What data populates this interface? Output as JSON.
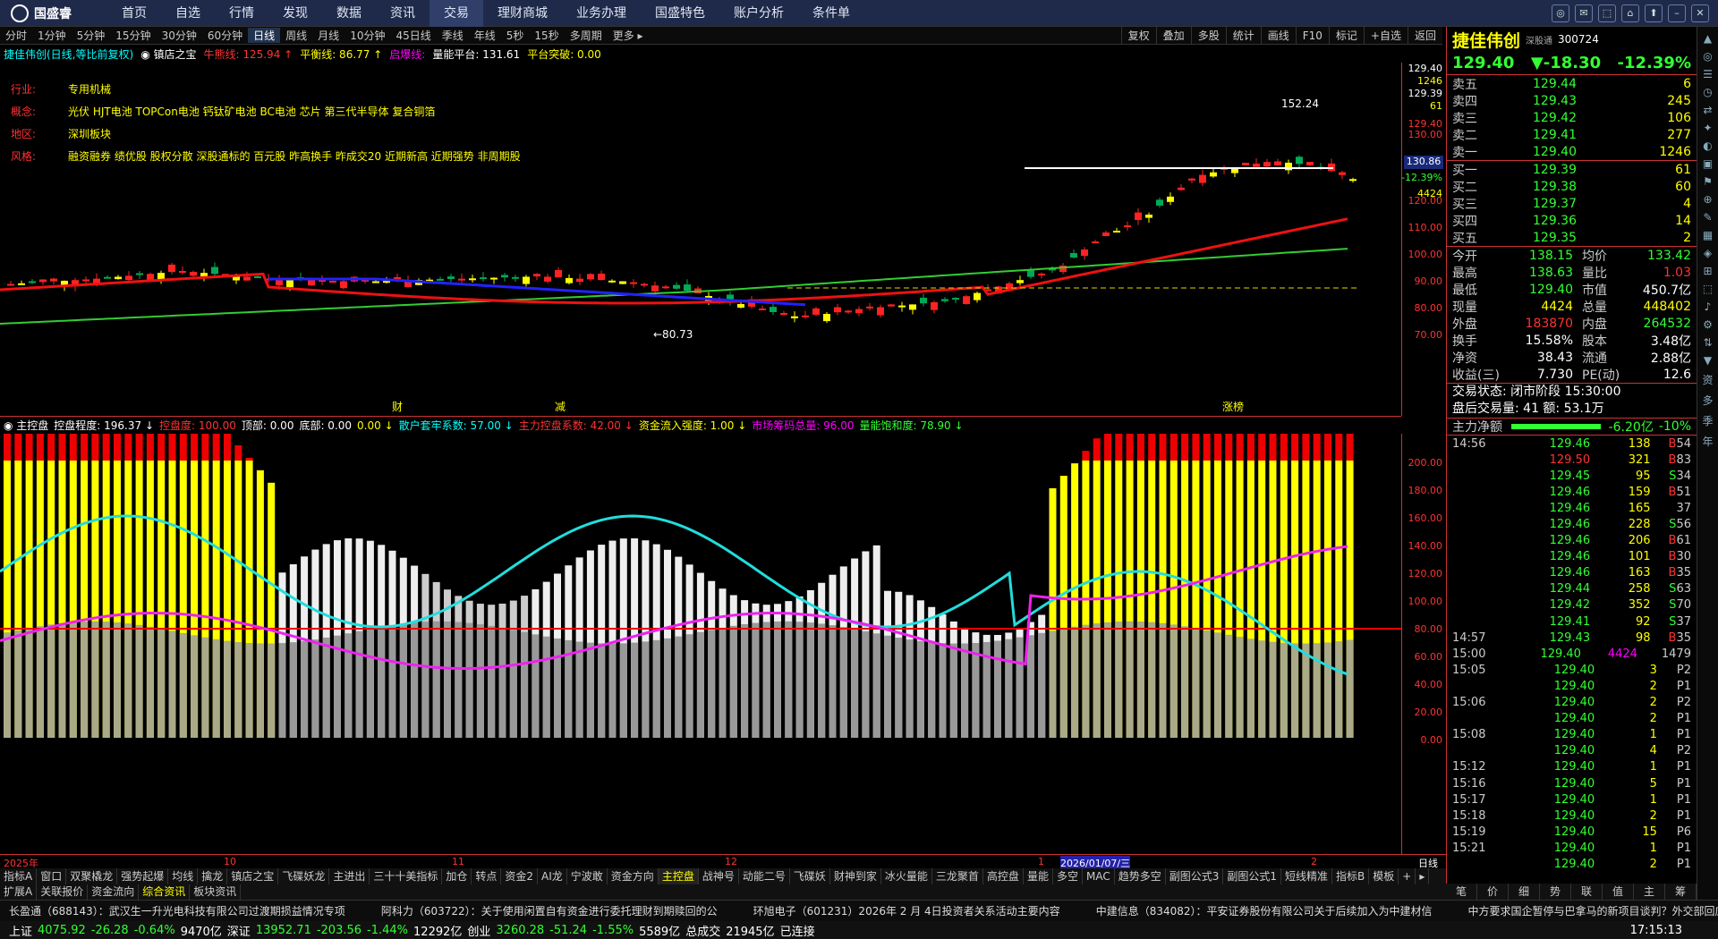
{
  "app": {
    "name": "国盛睿",
    "menu": [
      "首页",
      "自选",
      "行情",
      "发现",
      "数据",
      "资讯",
      "交易",
      "理财商城",
      "业务办理",
      "国盛特色",
      "账户分析",
      "条件单"
    ],
    "active_menu": "交易",
    "win_icons": [
      "◎",
      "✉",
      "⬚",
      "⌂",
      "⬆",
      "–",
      "✕"
    ]
  },
  "periods": {
    "items": [
      "分时",
      "1分钟",
      "5分钟",
      "15分钟",
      "30分钟",
      "60分钟",
      "日线",
      "周线",
      "月线",
      "10分钟",
      "45日线",
      "季线",
      "年线",
      "5秒",
      "15秒",
      "多周期",
      "更多 ▸"
    ],
    "active": "日线"
  },
  "chart_tools": [
    "复权",
    "叠加",
    "多股",
    "统计",
    "画线",
    "F10",
    "标记",
    "+自选",
    "返回"
  ],
  "infobar": {
    "title": "捷佳伟创(日线,等比前复权)",
    "sub": "◉ 镇店之宝",
    "i1": "牛熊线: 125.94 ↑",
    "i2": "平衡线: 86.77 ↑",
    "i3": "启爆线:",
    "i4": "量能平台: 131.61",
    "i5": "平台突破: 0.00"
  },
  "stockinfo": [
    {
      "label": "行业:",
      "value": "专用机械"
    },
    {
      "label": "概念:",
      "value": "光伏 HJT电池 TOPCon电池 钙钛矿电池 BC电池 芯片 第三代半导体 复合铜箔"
    },
    {
      "label": "地区:",
      "value": "深圳板块"
    },
    {
      "label": "风格:",
      "value": "融资融券 绩优股 股权分散 深股通标的 百元股 昨高换手 昨成交20 近期新高 近期强势 非周期股"
    }
  ],
  "chart_labels": {
    "high": "152.24",
    "low": "←80.73",
    "price_box": "130.86",
    "price_box_pct": "-12.39%",
    "price_box_vol": "4424",
    "marks": [
      "财",
      "减",
      "涨榜"
    ]
  },
  "y1": [
    "129.40",
    "1246",
    "129.39",
    "61",
    "129.40",
    "130.00",
    "120.00",
    "110.00",
    "100.00",
    "90.00",
    "80.00",
    "70.00"
  ],
  "indicator": {
    "name": "◉ 主控盘",
    "items": [
      "控盘程度: 196.37 ↓",
      "控盘度: 100.00",
      "顶部: 0.00",
      "底部: 0.00",
      "0.00 ↓",
      "散户套牢系数: 57.00 ↓",
      "主力控盘系数: 42.00 ↓",
      "资金流入强度: 1.00 ↓",
      "市场筹码总量: 96.00",
      "量能饱和度: 78.90 ↓"
    ]
  },
  "y2": [
    "200.00",
    "180.00",
    "160.00",
    "140.00",
    "120.00",
    "100.00",
    "80.00",
    "60.00",
    "40.00",
    "20.00",
    "0.00"
  ],
  "xaxis": [
    "2025年",
    "10",
    "11",
    "12",
    "1",
    "2026/01/07/三",
    "2"
  ],
  "tabs1": [
    "指标A",
    "窗口",
    "双聚橇龙",
    "强势起爆",
    "均线",
    "擒龙",
    "镇店之宝",
    "飞碟妖龙",
    "主进出",
    "三十十美指标",
    "加仓",
    "转点",
    "资金2",
    "AI龙",
    "宁波敢",
    "资金方向",
    "主控盘",
    "战神号",
    "动能二号",
    "飞碟妖",
    "财神到家",
    "冰火量能",
    "三龙聚首",
    "高控盘",
    "量能",
    "多空",
    "MAC",
    "趋势多空",
    "副图公式3",
    "副图公式1",
    "短线精准",
    "指标B",
    "模板",
    "+",
    "▸"
  ],
  "tabs1_active": "主控盘",
  "tabs2": [
    "扩展A",
    "关联报价",
    "资金流向",
    "综合资讯",
    "板块资讯"
  ],
  "news": [
    "长盈通（688143）：武汉生一升光电科技有限公司过渡期损益情况专项",
    "阿科力（603722）：关于使用闲置自有资金进行委托理财到期赎回的公",
    "环旭电子（601231）2026年 2 月 4日投资者关系活动主要内容",
    "中建信息（834082）：平安证券股份有限公司关于后续加入为中建材信",
    "中方要求国企暂停与巴拿马的新项目谈判？外交部回应"
  ],
  "status": {
    "sh_n": "上证",
    "sh": "4075.92",
    "sh_c": "-26.28",
    "sh_p": "-0.64%",
    "sh_v": "9470亿",
    "sz_n": "深证",
    "sz": "13952.71",
    "sz_c": "-203.56",
    "sz_p": "-1.44%",
    "sz_v": "12292亿",
    "cy_n": "创业",
    "cy": "3260.28",
    "cy_c": "-51.24",
    "cy_p": "-1.55%",
    "cy_v": "5589亿",
    "tot_n": "总成交",
    "tot": "21945亿",
    "conn": "已连接",
    "time": "17:15:13"
  },
  "quote": {
    "name": "捷佳伟创",
    "tag": "深股通",
    "code": "300724",
    "price": "129.40",
    "change": "▼-18.30",
    "pct": "-12.39%",
    "asks": [
      [
        "卖五",
        "129.44",
        "6"
      ],
      [
        "卖四",
        "129.43",
        "245"
      ],
      [
        "卖三",
        "129.42",
        "106"
      ],
      [
        "卖二",
        "129.41",
        "277"
      ],
      [
        "卖一",
        "129.40",
        "1246"
      ]
    ],
    "bids": [
      [
        "买一",
        "129.39",
        "61"
      ],
      [
        "买二",
        "129.38",
        "60"
      ],
      [
        "买三",
        "129.37",
        "4"
      ],
      [
        "买四",
        "129.36",
        "14"
      ],
      [
        "买五",
        "129.35",
        "2"
      ]
    ],
    "stats": [
      [
        "今开",
        "138.15",
        "均价",
        "133.42"
      ],
      [
        "最高",
        "138.63",
        "量比",
        "1.03"
      ],
      [
        "最低",
        "129.40",
        "市值",
        "450.7亿"
      ],
      [
        "现量",
        "4424",
        "总量",
        "448402"
      ],
      [
        "外盘",
        "183870",
        "内盘",
        "264532"
      ],
      [
        "换手",
        "15.58%",
        "股本",
        "3.48亿"
      ],
      [
        "净资",
        "38.43",
        "流通",
        "2.88亿"
      ],
      [
        "收益(三)",
        "7.730",
        "PE(动)",
        "12.6"
      ]
    ],
    "state1": "交易状态: 闭市阶段 15:30:00",
    "state2": "盘后交易量: 41  额: 53.1万",
    "netflow_label": "主力净额",
    "netflow_val": "-6.20亿",
    "netflow_pct": "-10%"
  },
  "ticks": [
    [
      "14:56",
      "129.46",
      "138",
      "B",
      "54"
    ],
    [
      "",
      "129.50",
      "321",
      "B",
      "83"
    ],
    [
      "",
      "129.45",
      "95",
      "S",
      "34"
    ],
    [
      "",
      "129.46",
      "159",
      "B",
      "51"
    ],
    [
      "",
      "129.46",
      "165",
      "",
      "37"
    ],
    [
      "",
      "129.46",
      "228",
      "S",
      "56"
    ],
    [
      "",
      "129.46",
      "206",
      "B",
      "61"
    ],
    [
      "",
      "129.46",
      "101",
      "B",
      "30"
    ],
    [
      "",
      "129.46",
      "163",
      "B",
      "35"
    ],
    [
      "",
      "129.44",
      "258",
      "S",
      "63"
    ],
    [
      "",
      "129.42",
      "352",
      "S",
      "70"
    ],
    [
      "",
      "129.41",
      "92",
      "S",
      "37"
    ],
    [
      "14:57",
      "129.43",
      "98",
      "B",
      "35"
    ],
    [
      "15:00",
      "129.40",
      "4424",
      "",
      "1479"
    ],
    [
      "15:05",
      "129.40",
      "3",
      "P",
      "2"
    ],
    [
      "",
      "129.40",
      "2",
      "P",
      "1"
    ],
    [
      "15:06",
      "129.40",
      "2",
      "P",
      "2"
    ],
    [
      "",
      "129.40",
      "2",
      "P",
      "1"
    ],
    [
      "15:08",
      "129.40",
      "1",
      "P",
      "1"
    ],
    [
      "",
      "129.40",
      "4",
      "P",
      "2"
    ],
    [
      "15:12",
      "129.40",
      "1",
      "P",
      "1"
    ],
    [
      "15:16",
      "129.40",
      "5",
      "P",
      "1"
    ],
    [
      "15:17",
      "129.40",
      "1",
      "P",
      "1"
    ],
    [
      "15:18",
      "129.40",
      "2",
      "P",
      "1"
    ],
    [
      "15:19",
      "129.40",
      "15",
      "P",
      "6"
    ],
    [
      "15:21",
      "129.40",
      "1",
      "P",
      "1"
    ],
    [
      "",
      "129.40",
      "2",
      "P",
      "1"
    ]
  ],
  "rtabs": [
    "笔",
    "价",
    "细",
    "势",
    "联",
    "值",
    "主",
    "筹"
  ],
  "side": [
    "▲",
    "◎",
    "☰",
    "◷",
    "⇄",
    "✦",
    "◐",
    "▣",
    "⚑",
    "⊕",
    "✎",
    "▦",
    "◈",
    "⊞",
    "⬚",
    "♪",
    "⚙",
    "⇅",
    "▼",
    "资",
    "多",
    "季",
    "年"
  ]
}
